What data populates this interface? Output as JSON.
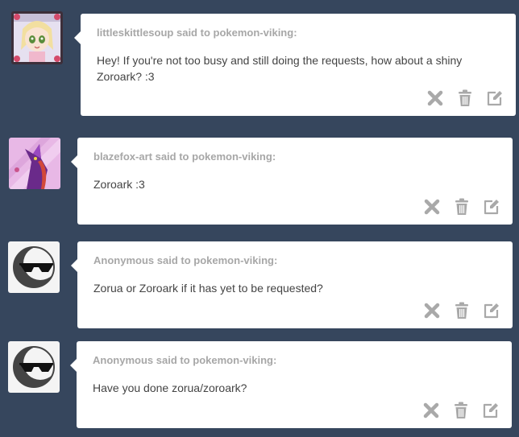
{
  "asks": [
    {
      "asker": "littleskittlesoup",
      "recipient": "pokemon-viking",
      "said_to": "said to",
      "message": "Hey! If you're not too busy and still doing the requests, how about a shiny Zoroark? :3",
      "avatar": "anime-girl-avatar"
    },
    {
      "asker": "blazefox-art",
      "recipient": "pokemon-viking",
      "said_to": "said to",
      "message": "Zoroark :3",
      "avatar": "purple-fox-avatar"
    },
    {
      "asker": "Anonymous",
      "recipient": "pokemon-viking",
      "said_to": "said to",
      "message": "Zorua or Zoroark if it has yet to be requested?",
      "avatar": "anonymous-sunglasses-avatar"
    },
    {
      "asker": "Anonymous",
      "recipient": "pokemon-viking",
      "said_to": "said to",
      "message": "Have you done zorua/zoroark?",
      "avatar": "anonymous-sunglasses-avatar"
    }
  ],
  "icons": {
    "delete": "x-icon",
    "trash": "trash-icon",
    "answer": "edit-icon"
  },
  "colors": {
    "background": "#36465d",
    "card": "#ffffff",
    "asker_text": "#a7a7a7",
    "message_text": "#444444",
    "icon": "#a9a9a9"
  }
}
